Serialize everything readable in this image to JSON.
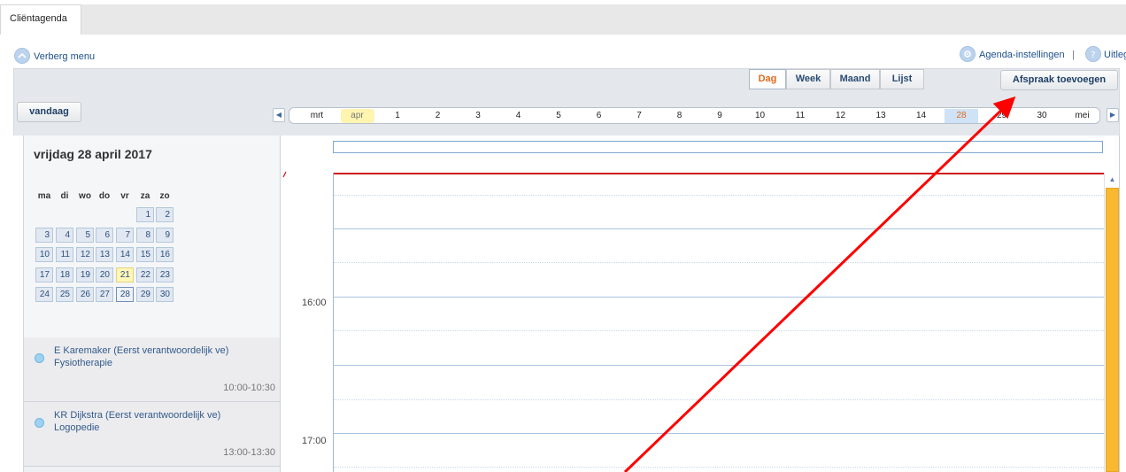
{
  "tabs": [
    {
      "label": "Cliëntagenda"
    }
  ],
  "menu": {
    "hide_menu": "Verberg menu",
    "settings": "Agenda-instellingen",
    "separator": "|",
    "help": "Uitleg"
  },
  "views": [
    {
      "label": "Dag",
      "active": true
    },
    {
      "label": "Week",
      "active": false
    },
    {
      "label": "Maand",
      "active": false
    },
    {
      "label": "Lijst",
      "active": false
    }
  ],
  "buttons": {
    "add_appointment": "Afspraak toevoegen",
    "today": "vandaag"
  },
  "datebar": {
    "items": [
      "mrt",
      "apr",
      "1",
      "2",
      "3",
      "4",
      "5",
      "6",
      "7",
      "8",
      "9",
      "10",
      "11",
      "12",
      "13",
      "14",
      "28",
      "29",
      "30",
      "mei"
    ],
    "selected": "28",
    "current_month": "apr"
  },
  "calendar": {
    "title": "vrijdag 28 april 2017",
    "weekdays": [
      "ma",
      "di",
      "wo",
      "do",
      "vr",
      "za",
      "zo"
    ],
    "weeks": [
      [
        "",
        "",
        "",
        "",
        "",
        "1",
        "2"
      ],
      [
        "3",
        "4",
        "5",
        "6",
        "7",
        "8",
        "9"
      ],
      [
        "10",
        "11",
        "12",
        "13",
        "14",
        "15",
        "16"
      ],
      [
        "17",
        "18",
        "19",
        "20",
        "21",
        "22",
        "23"
      ],
      [
        "24",
        "25",
        "26",
        "27",
        "28",
        "29",
        "30"
      ]
    ],
    "today": "21",
    "selected": "28"
  },
  "appointments": [
    {
      "name": "E Karemaker (Eerst verantwoordelijk ve)",
      "type": "Fysiotherapie",
      "time": "10:00-10:30"
    },
    {
      "name": "KR Dijkstra (Eerst verantwoordelijk ve)",
      "type": "Logopedie",
      "time": "13:00-13:30"
    }
  ],
  "dayview": {
    "times": [
      "16:00",
      "17:00"
    ]
  },
  "colors": {
    "accent": "#e06a1a",
    "now_line": "#d01818",
    "scroll_thumb": "#f8b930",
    "annotation_arrow": "#ff0000"
  },
  "icons": {
    "hide_menu": "menu-toggle-icon",
    "settings": "gear-icon",
    "help": "question-icon"
  }
}
